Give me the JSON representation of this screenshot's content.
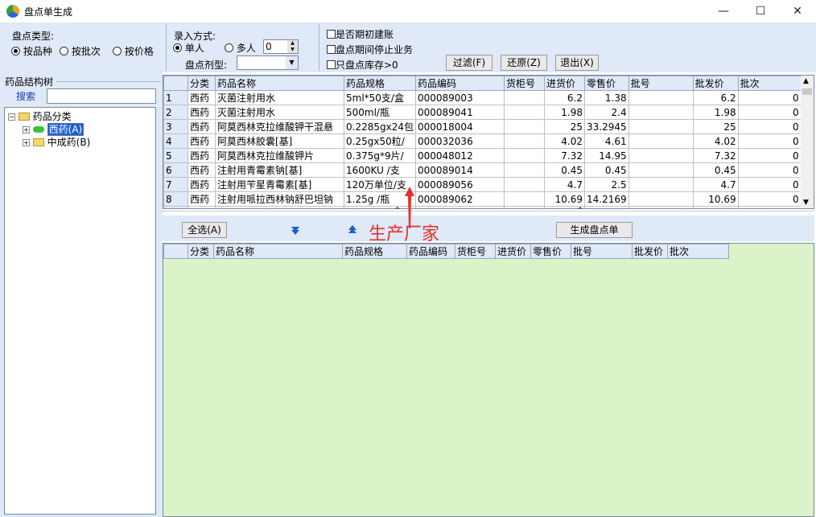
{
  "window": {
    "title": "盘点单生成",
    "min": "—",
    "max": "☐",
    "close": "✕"
  },
  "inventory_type": {
    "label": "盘点类型:",
    "options": [
      {
        "label": "按品种",
        "selected": true
      },
      {
        "label": "按批次",
        "selected": false
      },
      {
        "label": "按价格",
        "selected": false
      }
    ]
  },
  "entry_mode": {
    "label": "录入方式:",
    "single": "单人",
    "multi": "多人",
    "count": "0",
    "dosage_label": "盘点剂型:",
    "dosage_value": ""
  },
  "checks": [
    {
      "label": "是否期初建账",
      "checked": false
    },
    {
      "label": "盘点期间停止业务",
      "checked": false
    },
    {
      "label": "只盘点库存>0",
      "checked": false
    }
  ],
  "buttons": {
    "filter": "过滤(F)",
    "restore": "还原(Z)",
    "exit": "退出(X)",
    "select_all": "全选(A)",
    "generate": "生成盘点单"
  },
  "tree": {
    "title": "药品结构树",
    "search_label": "搜索",
    "search_value": "",
    "root": "药品分类",
    "children": [
      "西药(A)",
      "中成药(B)"
    ]
  },
  "grid": {
    "columns": [
      "",
      "分类",
      "药品名称",
      "药品规格",
      "药品编码",
      "货柜号",
      "进货价",
      "零售价",
      "批号",
      "批发价",
      "批次"
    ],
    "rows": [
      [
        "1",
        "西药",
        "灭菌注射用水",
        "5ml*50支/盒",
        "000089003",
        "",
        "6.2",
        "1.38",
        "",
        "6.2",
        "0"
      ],
      [
        "2",
        "西药",
        "灭菌注射用水",
        "500ml/瓶",
        "000089041",
        "",
        "1.98",
        "2.4",
        "",
        "1.98",
        "0"
      ],
      [
        "3",
        "西药",
        "阿莫西林克拉维酸钾干混悬",
        "0.2285gx24包",
        "000018004",
        "",
        "25",
        "33.2945",
        "",
        "25",
        "0"
      ],
      [
        "4",
        "西药",
        "阿莫西林胶囊[基]",
        "0.25gx50粒/",
        "000032036",
        "",
        "4.02",
        "4.61",
        "",
        "4.02",
        "0"
      ],
      [
        "5",
        "西药",
        "阿莫西林克拉维酸钾片",
        "0.375g*9片/",
        "000048012",
        "",
        "7.32",
        "14.95",
        "",
        "7.32",
        "0"
      ],
      [
        "6",
        "西药",
        "注射用青霉素钠[基]",
        "1600KU /支",
        "000089014",
        "",
        "0.45",
        "0.45",
        "",
        "0.45",
        "0"
      ],
      [
        "7",
        "西药",
        "注射用苄星青霉素[基]",
        "120万单位/支",
        "000089056",
        "",
        "4.7",
        "2.5",
        "",
        "4.7",
        "0"
      ],
      [
        "8",
        "西药",
        "注射用哌拉西林钠舒巴坦钠",
        "1.25g /瓶",
        "000089062",
        "",
        "10.69",
        "14.2169",
        "",
        "10.69",
        "0"
      ]
    ]
  },
  "grid2": {
    "columns": [
      "",
      "分类",
      "药品名称",
      "药品规格",
      "药品编码",
      "货柜号",
      "进货价",
      "零售价",
      "批号",
      "批发价",
      "批次"
    ]
  },
  "annotation": {
    "text": "生产厂家",
    "color": "#e8302a"
  },
  "colors": {
    "panel": "#dfe9f7",
    "lower_grid": "#dcf2c8"
  }
}
